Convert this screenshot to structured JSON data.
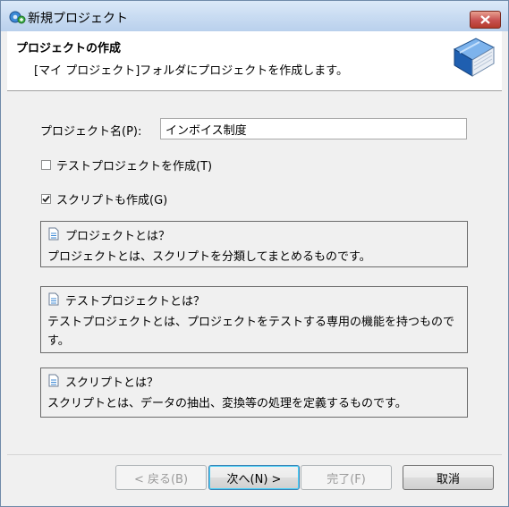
{
  "window": {
    "title": "新規プロジェクト"
  },
  "header": {
    "title": "プロジェクトの作成",
    "description": "[マイ プロジェクト]フォルダにプロジェクトを作成します。"
  },
  "form": {
    "project_name_label": "プロジェクト名(P):",
    "project_name_value": "インボイス制度",
    "test_project_label": "テストプロジェクトを作成(T)",
    "test_project_checked": false,
    "script_label": "スクリプトも作成(G)",
    "script_checked": true
  },
  "info": [
    {
      "title": "プロジェクトとは？",
      "body": "プロジェクトとは、スクリプトを分類してまとめるものです。"
    },
    {
      "title": "テストプロジェクトとは？",
      "body": "テストプロジェクトとは、プロジェクトをテストする専用の機能を持つものです。"
    },
    {
      "title": "スクリプトとは？",
      "body": "スクリプトとは、データの抽出、変換等の処理を定義するものです。"
    }
  ],
  "buttons": {
    "back": "< 戻る(B)",
    "next": "次へ(N) >",
    "finish": "完了(F)",
    "cancel": "取消"
  },
  "icons": {
    "title_icon": "app-gear-icon",
    "header_icon": "blue-book-icon",
    "info_icon": "document-icon",
    "close_icon": "close-icon"
  }
}
